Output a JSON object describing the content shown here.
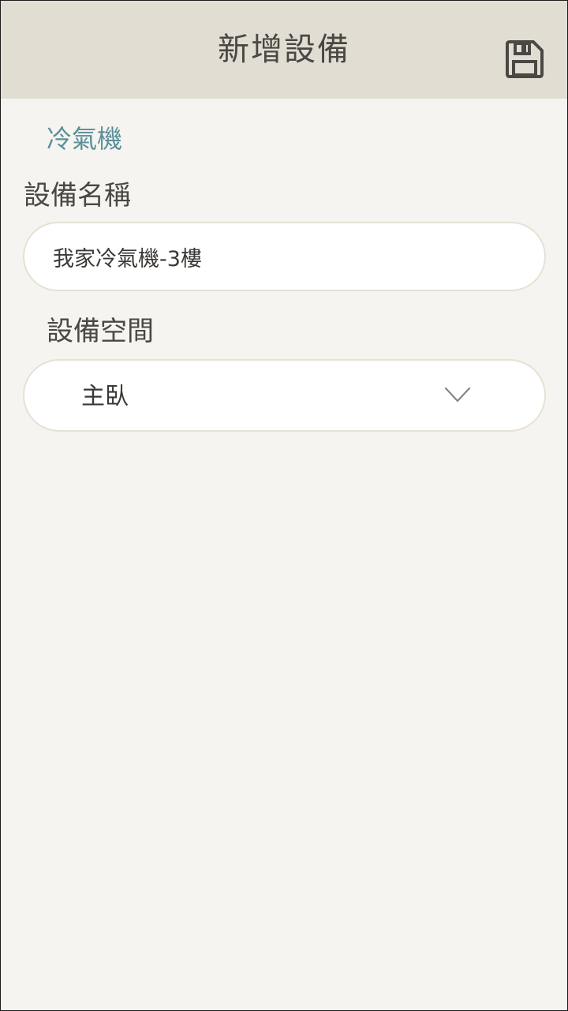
{
  "header": {
    "title": "新增設備",
    "save_icon": "save-floppy-icon"
  },
  "device": {
    "type_label": "冷氣機"
  },
  "form": {
    "name_label": "設備名稱",
    "name_value": "我家冷氣機-3樓",
    "space_label": "設備空間",
    "space_value": "主臥",
    "space_dropdown_icon": "chevron-down-icon"
  },
  "colors": {
    "header_bg": "#e1ddd2",
    "page_bg": "#f5f4f0",
    "accent_teal": "#5a8f98",
    "text_dark": "#4a4744",
    "field_border": "#e6e1d4"
  }
}
